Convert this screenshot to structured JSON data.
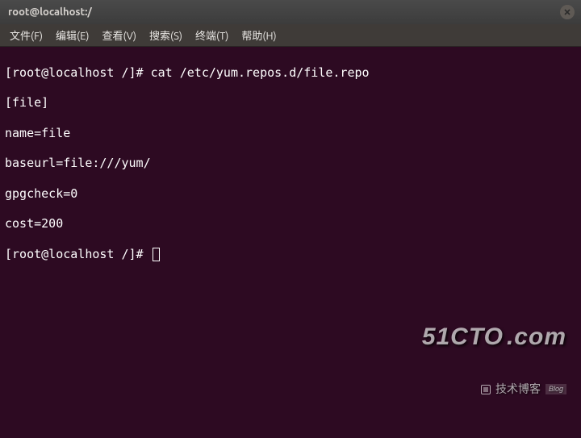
{
  "titlebar": {
    "title": "root@localhost:/"
  },
  "menubar": {
    "items": [
      "文件(F)",
      "编辑(E)",
      "查看(V)",
      "搜索(S)",
      "终端(T)",
      "帮助(H)"
    ]
  },
  "terminal": {
    "prompt": "[root@localhost /]# ",
    "command1": "cat /etc/yum.repos.d/file.repo",
    "output": [
      "[file]",
      "name=file",
      "baseurl=file:///yum/",
      "gpgcheck=0",
      "cost=200"
    ]
  },
  "watermark": {
    "brand": "51CTO",
    "domain": ".com",
    "tag": "技术博客",
    "blog": "Blog"
  }
}
